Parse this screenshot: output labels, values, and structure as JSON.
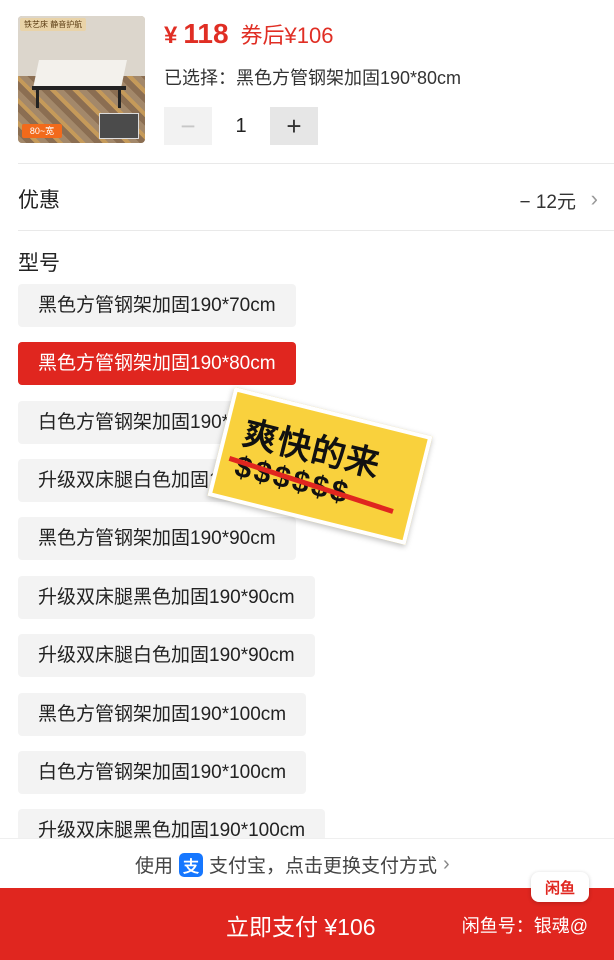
{
  "product": {
    "price_symbol": "¥",
    "price": "118",
    "coupon_price": "券后¥106",
    "selected_text": "已选择：黑色方管钢架加固190*80cm",
    "thumbnail": {
      "badge_top": "铁艺床 静音护航",
      "badge_bottom": "80~宽"
    }
  },
  "quantity": {
    "minus": "−",
    "value": "1",
    "plus": "+"
  },
  "discount": {
    "label": "优惠",
    "value": "− 12元",
    "chevron": "›"
  },
  "model": {
    "title": "型号",
    "options": [
      "黑色方管钢架加固190*70cm",
      "黑色方管钢架加固190*80cm",
      "白色方管钢架加固190*80cm",
      "升级双床腿白色加固190*80cm",
      "黑色方管钢架加固190*90cm",
      "升级双床腿黑色加固190*90cm",
      "升级双床腿白色加固190*90cm",
      "黑色方管钢架加固190*100cm",
      "白色方管钢架加固190*100cm",
      "升级双床腿黑色加固190*100cm"
    ],
    "selected_index": 1
  },
  "sticker": {
    "text": "爽快的来",
    "dollars": "$$$$$$"
  },
  "payment": {
    "prefix": "使用",
    "logo": "支",
    "text": "支付宝，点击更换支付方式",
    "chevron": "›"
  },
  "footer": {
    "buy_label": "立即支付 ¥106",
    "seller": "闲鱼号：银魂@",
    "badge": "闲鱼"
  },
  "colors": {
    "accent": "#e0261f",
    "alipay": "#1677ff",
    "sticker": "#f9d13d"
  }
}
